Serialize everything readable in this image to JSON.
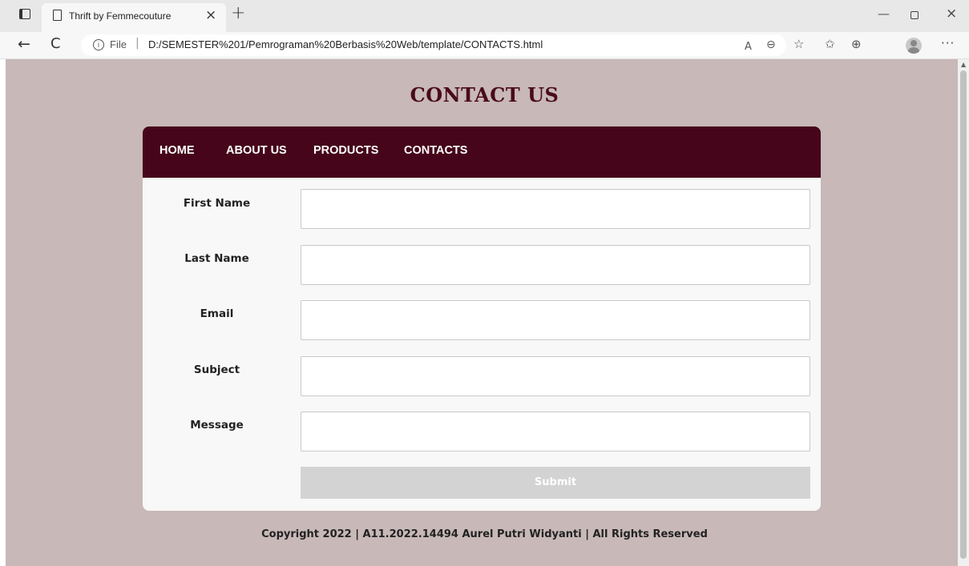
{
  "browser": {
    "tab_title": "Thrift by Femmecouture",
    "tab_close": "×",
    "new_tab": "+",
    "addr_file_label": "File",
    "addr_separator": "|",
    "url": "D:/SEMESTER%201/Pemrograman%20Berbasis%20Web/template/CONTACTS.html",
    "icons": {
      "back": "←",
      "refresh": "C",
      "read_aloud": "A",
      "zoom": "⊖",
      "favorite": "☆",
      "favorites_bar": "✩",
      "collections": "⊕",
      "more": "···",
      "minimize": "—",
      "close": "×"
    }
  },
  "page": {
    "title": "CONTACT US",
    "nav": {
      "home": "HOME",
      "about": "ABOUT US",
      "products": "PRODUCTS",
      "contacts": "CONTACTS"
    },
    "form": {
      "first_name_label": "First Name",
      "last_name_label": "Last Name",
      "email_label": "Email",
      "subject_label": "Subject",
      "message_label": "Message",
      "first_name_value": "",
      "last_name_value": "",
      "email_value": "",
      "subject_value": "",
      "message_value": "",
      "submit_label": "Submit"
    },
    "footer": "Copyright 2022 | A11.2022.14494 Aurel Putri Widyanti | All Rights Reserved"
  },
  "colors": {
    "page_background": "#c8b8b8",
    "navbar": "#46051a",
    "title": "#4a0a1c",
    "card": "#f8f8f8",
    "submit": "#d3d3d3"
  }
}
